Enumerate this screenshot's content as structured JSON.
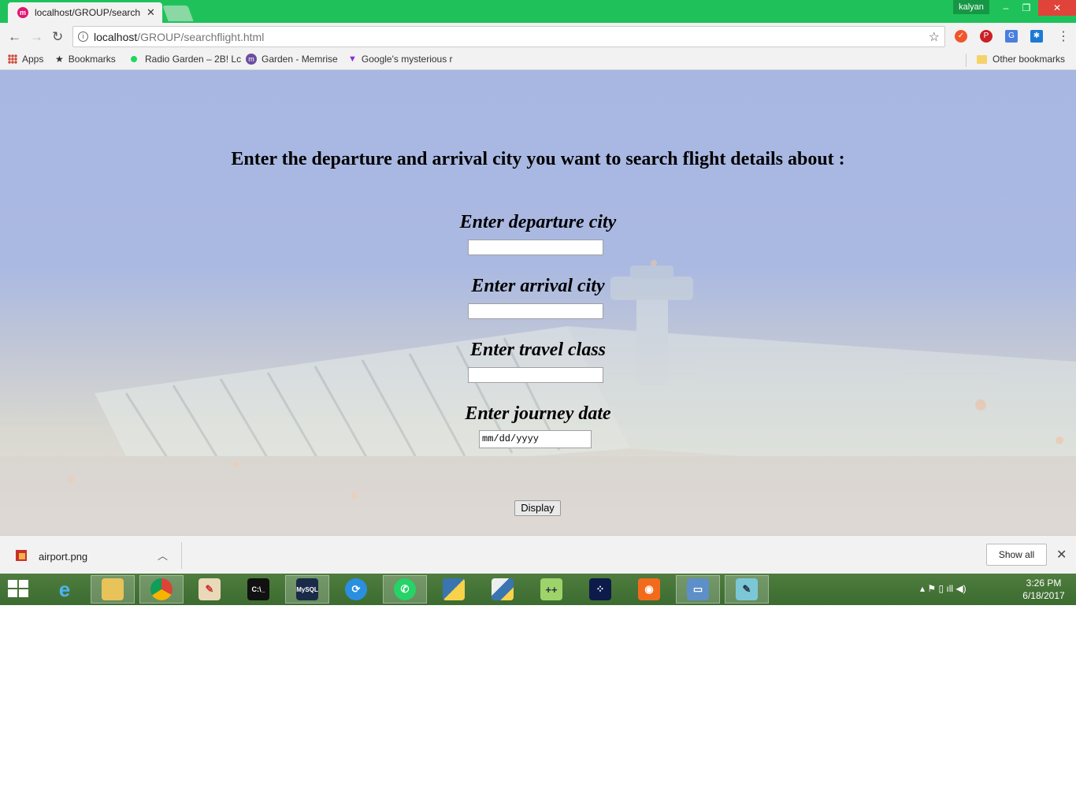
{
  "browser": {
    "tab_title": "localhost/GROUP/searchf",
    "tab_favicon": "m",
    "user": "kalyan",
    "url_host": "localhost",
    "url_path": "/GROUP/searchflight.html",
    "extensions": [
      "brave-icon",
      "pinterest-icon",
      "translate-icon",
      "snowflake-icon"
    ]
  },
  "bookmarks": {
    "apps": "Apps",
    "bookmarks": "Bookmarks",
    "radio": "Radio Garden – 2B! Lc",
    "memrise": "Garden - Memrise",
    "google": "Google's mysterious r",
    "other": "Other bookmarks"
  },
  "form": {
    "heading": "Enter the departure and arrival city you want to search flight details about :",
    "departure_label": "Enter departure city",
    "departure_value": "",
    "arrival_label": "Enter arrival city",
    "arrival_value": "",
    "class_label": "Enter travel class",
    "class_value": "",
    "date_label": "Enter journey date",
    "date_placeholder": "mm/dd/yyyy",
    "submit_label": "Display"
  },
  "downloads": {
    "file_name": "airport.png",
    "show_all": "Show all"
  },
  "taskbar": {
    "time": "3:26 PM",
    "date": "6/18/2017"
  }
}
